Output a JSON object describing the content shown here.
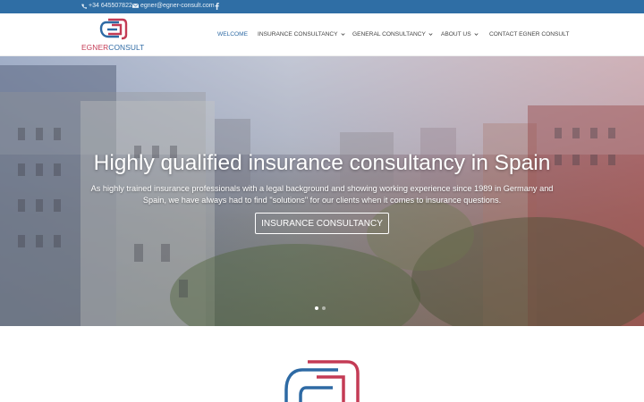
{
  "topbar": {
    "phone": "+34 645507822",
    "email": "egner@egner-consult.com",
    "social_icon": "facebook-icon"
  },
  "logo": {
    "word_part1": "EGNER",
    "word_part2": "CONSULT",
    "colors": {
      "red": "#c43b55",
      "blue": "#2e6aa4"
    }
  },
  "nav": {
    "items": [
      {
        "label": "WELCOME",
        "active": true,
        "dropdown": false
      },
      {
        "label": "INSURANCE CONSULTANCY",
        "active": false,
        "dropdown": true
      },
      {
        "label": "GENERAL CONSULTANCY",
        "active": false,
        "dropdown": true
      },
      {
        "label": "ABOUT US",
        "active": false,
        "dropdown": true
      },
      {
        "label": "CONTACT EGNER CONSULT",
        "active": false,
        "dropdown": false
      }
    ]
  },
  "hero": {
    "title": "Highly qualified insurance consultancy in Spain",
    "text": "As highly trained insurance professionals with a legal background and showing working experience since 1989 in Germany and Spain, we have always had to find \"solutions\" for our clients when it comes to insurance questions.",
    "button_label": "INSURANCE CONSULTANCY",
    "slide_count": 2,
    "active_slide": 1
  },
  "colors": {
    "topbar": "#2f6ea5",
    "accent": "#2e6aa4"
  }
}
